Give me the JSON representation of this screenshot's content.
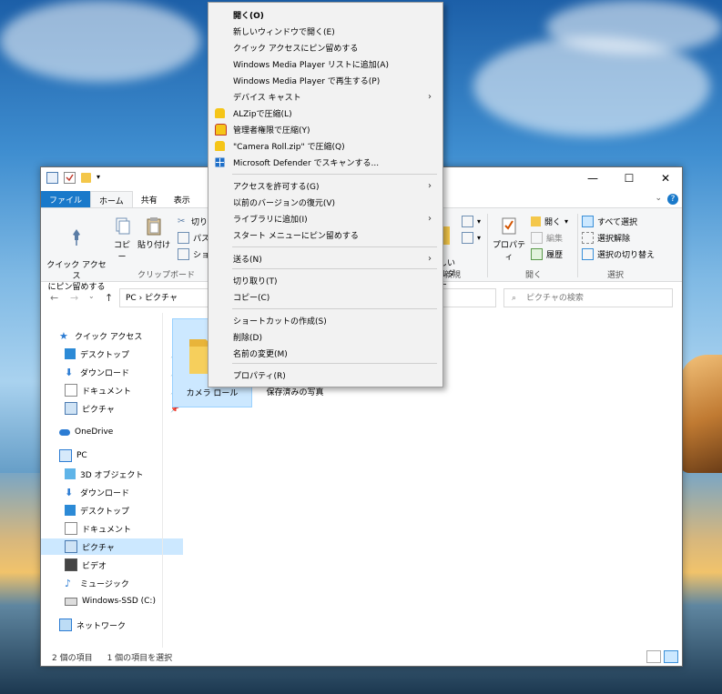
{
  "window": {
    "tabs": [
      "ファイル",
      "ホーム",
      "共有",
      "表示"
    ],
    "controls": {
      "minimize": "—",
      "maximize": "☐",
      "close": "✕"
    },
    "ribbon": {
      "pin_quick": "クイック アクセス\nにピン留めする",
      "copy": "コピー",
      "paste": "貼り付け",
      "cut": "切り取",
      "copy_path": "パスの",
      "paste_shortcut": "ショー",
      "clipboard_group": "クリップボード",
      "new_folder": "しい\nルダー",
      "new_group": "新規",
      "properties": "プロパティ",
      "open_label": "開く",
      "edit_label": "編集",
      "history_label": "履歴",
      "open_group": "開く",
      "select_all": "すべて選択",
      "select_none": "選択解除",
      "invert_select": "選択の切り替え",
      "select_group": "選択"
    },
    "address": {
      "path": "PC  ›  ピクチャ"
    },
    "search": {
      "placeholder": "ピクチャの検索"
    },
    "sidebar": {
      "items": [
        {
          "label": "クイック アクセス"
        },
        {
          "label": "デスクトップ"
        },
        {
          "label": "ダウンロード"
        },
        {
          "label": "ドキュメント"
        },
        {
          "label": "ピクチャ"
        },
        {
          "label": "OneDrive"
        },
        {
          "label": "PC"
        },
        {
          "label": "3D オブジェクト"
        },
        {
          "label": "ダウンロード"
        },
        {
          "label": "デスクトップ"
        },
        {
          "label": "ドキュメント"
        },
        {
          "label": "ピクチャ"
        },
        {
          "label": "ビデオ"
        },
        {
          "label": "ミュージック"
        },
        {
          "label": "Windows-SSD (C:)"
        },
        {
          "label": "ネットワーク"
        }
      ]
    },
    "folders": [
      {
        "label": "カメラ ロール",
        "selected": true
      },
      {
        "label": "保存済みの写真",
        "selected": false
      }
    ],
    "status": {
      "count": "2 個の項目",
      "selected": "1 個の項目を選択"
    }
  },
  "context_menu": {
    "items": [
      {
        "label": "開く(O)",
        "bold": true
      },
      {
        "label": "新しいウィンドウで開く(E)"
      },
      {
        "label": "クイック アクセスにピン留めする"
      },
      {
        "label": "Windows Media Player リストに追加(A)"
      },
      {
        "label": "Windows Media Player で再生する(P)"
      },
      {
        "label": "デバイス キャスト",
        "submenu": true
      },
      {
        "label": "ALZipで圧縮(L)",
        "icon": "alzip-icon"
      },
      {
        "label": "管理者権限で圧縮(Y)",
        "icon": "admin-compress-icon"
      },
      {
        "label": "\"Camera Roll.zip\" で圧縮(Q)",
        "icon": "alzip-icon"
      },
      {
        "label": "Microsoft Defender でスキャンする...",
        "icon": "defender-icon"
      },
      {
        "label": "アクセスを許可する(G)",
        "submenu": true
      },
      {
        "label": "以前のバージョンの復元(V)"
      },
      {
        "label": "ライブラリに追加(I)",
        "submenu": true
      },
      {
        "label": "スタート メニューにピン留めする"
      },
      {
        "label": "送る(N)",
        "submenu": true
      },
      {
        "label": "切り取り(T)"
      },
      {
        "label": "コピー(C)"
      },
      {
        "label": "ショートカットの作成(S)"
      },
      {
        "label": "削除(D)"
      },
      {
        "label": "名前の変更(M)"
      },
      {
        "label": "プロパティ(R)"
      }
    ],
    "submenu_arrow": "›"
  },
  "colors": {
    "accent": "#1979ca",
    "selection": "#cce8ff",
    "menu_bg": "#f2f2f2"
  }
}
